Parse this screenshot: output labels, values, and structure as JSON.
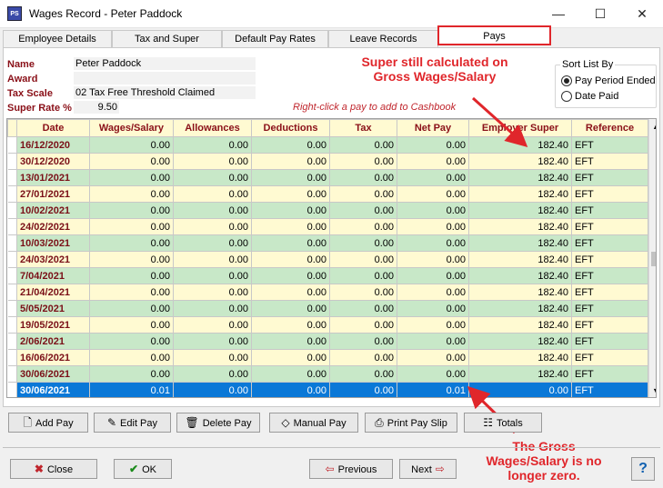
{
  "window": {
    "title": "Wages Record - Peter Paddock",
    "icon_text": "PS"
  },
  "tabs": [
    {
      "label": "Employee Details"
    },
    {
      "label": "Tax and Super"
    },
    {
      "label": "Default Pay Rates"
    },
    {
      "label": "Leave Records"
    },
    {
      "label": "Pays"
    }
  ],
  "info": {
    "name_label": "Name",
    "name_value": "Peter Paddock",
    "award_label": "Award",
    "award_value": "",
    "tax_label": "Tax Scale",
    "tax_value": "02 Tax Free Threshold Claimed",
    "super_label": "Super Rate %",
    "super_value": "9.50",
    "hint": "Right-click a pay to add to Cashbook"
  },
  "sort": {
    "title": "Sort List By",
    "opt1": "Pay Period Ended",
    "opt2": "Date Paid",
    "selected": "opt1"
  },
  "annotations": {
    "top": "Super still calculated on Gross Wages/Salary",
    "bottom": "The Gross Wages/Salary is no longer zero."
  },
  "grid": {
    "columns": [
      "Date",
      "Wages/Salary",
      "Allowances",
      "Deductions",
      "Tax",
      "Net Pay",
      "Employer Super",
      "Reference"
    ],
    "rows": [
      [
        "16/12/2020",
        "0.00",
        "0.00",
        "0.00",
        "0.00",
        "0.00",
        "182.40",
        "EFT"
      ],
      [
        "30/12/2020",
        "0.00",
        "0.00",
        "0.00",
        "0.00",
        "0.00",
        "182.40",
        "EFT"
      ],
      [
        "13/01/2021",
        "0.00",
        "0.00",
        "0.00",
        "0.00",
        "0.00",
        "182.40",
        "EFT"
      ],
      [
        "27/01/2021",
        "0.00",
        "0.00",
        "0.00",
        "0.00",
        "0.00",
        "182.40",
        "EFT"
      ],
      [
        "10/02/2021",
        "0.00",
        "0.00",
        "0.00",
        "0.00",
        "0.00",
        "182.40",
        "EFT"
      ],
      [
        "24/02/2021",
        "0.00",
        "0.00",
        "0.00",
        "0.00",
        "0.00",
        "182.40",
        "EFT"
      ],
      [
        "10/03/2021",
        "0.00",
        "0.00",
        "0.00",
        "0.00",
        "0.00",
        "182.40",
        "EFT"
      ],
      [
        "24/03/2021",
        "0.00",
        "0.00",
        "0.00",
        "0.00",
        "0.00",
        "182.40",
        "EFT"
      ],
      [
        "7/04/2021",
        "0.00",
        "0.00",
        "0.00",
        "0.00",
        "0.00",
        "182.40",
        "EFT"
      ],
      [
        "21/04/2021",
        "0.00",
        "0.00",
        "0.00",
        "0.00",
        "0.00",
        "182.40",
        "EFT"
      ],
      [
        "5/05/2021",
        "0.00",
        "0.00",
        "0.00",
        "0.00",
        "0.00",
        "182.40",
        "EFT"
      ],
      [
        "19/05/2021",
        "0.00",
        "0.00",
        "0.00",
        "0.00",
        "0.00",
        "182.40",
        "EFT"
      ],
      [
        "2/06/2021",
        "0.00",
        "0.00",
        "0.00",
        "0.00",
        "0.00",
        "182.40",
        "EFT"
      ],
      [
        "16/06/2021",
        "0.00",
        "0.00",
        "0.00",
        "0.00",
        "0.00",
        "182.40",
        "EFT"
      ],
      [
        "30/06/2021",
        "0.00",
        "0.00",
        "0.00",
        "0.00",
        "0.00",
        "182.40",
        "EFT"
      ],
      [
        "30/06/2021",
        "0.01",
        "0.00",
        "0.00",
        "0.00",
        "0.01",
        "0.00",
        "EFT"
      ]
    ],
    "selected_row": 15
  },
  "actions": {
    "add_pay": "Add Pay",
    "edit_pay": "Edit Pay",
    "delete_pay": "Delete Pay",
    "manual_pay": "Manual Pay",
    "print_pay_slip": "Print Pay Slip",
    "totals": "Totals"
  },
  "footer": {
    "close": "Close",
    "ok": "OK",
    "previous": "Previous",
    "next": "Next",
    "help": "?"
  },
  "colors": {
    "accent_red": "#e0262b",
    "row_green": "#c8e8c8",
    "row_yellow": "#fffad2",
    "selection": "#0a78d7"
  }
}
